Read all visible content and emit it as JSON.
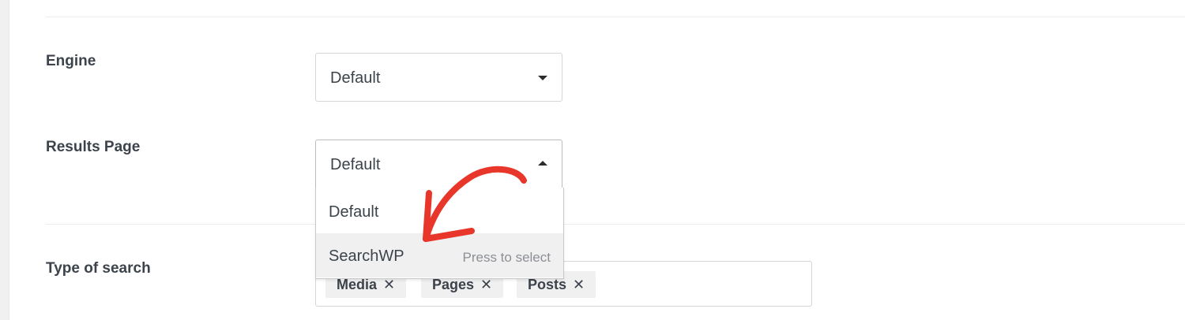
{
  "fields": {
    "engine": {
      "label": "Engine",
      "selected": "Default"
    },
    "results_page": {
      "label": "Results Page",
      "selected": "Default",
      "options": [
        {
          "label": "Default"
        },
        {
          "label": "SearchWP",
          "hint": "Press to select"
        }
      ]
    },
    "type_of_search": {
      "label": "Type of search",
      "tags": [
        {
          "label": "Media",
          "remove": "✕"
        },
        {
          "label": "Pages",
          "remove": "✕"
        },
        {
          "label": "Posts",
          "remove": "✕"
        }
      ]
    }
  },
  "annotation": {
    "color": "#e8372a",
    "shape": "curved-arrow"
  },
  "icons": {
    "engine_caret": "chevron-down-icon",
    "results_caret": "chevron-up-icon"
  }
}
